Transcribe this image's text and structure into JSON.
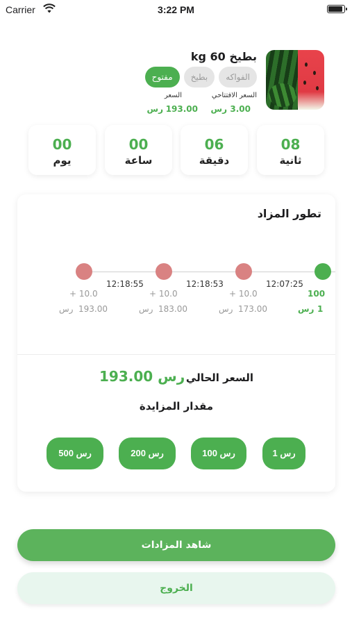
{
  "status_bar": {
    "carrier": "Carrier",
    "time": "3:22 PM"
  },
  "product": {
    "title": "بطيخ 60 kg",
    "tags": {
      "category": "الفواكه",
      "subcategory": "بطيخ",
      "status": "مفتوح"
    },
    "opening_price_label": "السعر الافتتاحي",
    "opening_price": "3.00",
    "price_label": "السعر",
    "price": "193.00",
    "currency": "رس"
  },
  "countdown": {
    "seconds": {
      "value": "08",
      "label": "ثانية"
    },
    "minutes": {
      "value": "06",
      "label": "دقيقة"
    },
    "hours": {
      "value": "00",
      "label": "ساعة"
    },
    "days": {
      "value": "00",
      "label": "يوم"
    }
  },
  "auction": {
    "title": "تطور المزاد",
    "timeline": [
      {
        "time": "12:18:55",
        "increment": "+ 10.0",
        "price": "193.00",
        "currency": "رس"
      },
      {
        "time": "12:18:53",
        "increment": "+ 10.0",
        "price": "183.00",
        "currency": "رس"
      },
      {
        "time": "12:07:25",
        "increment": "+ 10.0",
        "price": "173.00",
        "currency": "رس"
      },
      {
        "time": "",
        "increment": "100",
        "price": "1",
        "currency": "رس"
      }
    ],
    "current_price_label": "السعر الحالي",
    "current_price": "193.00",
    "currency": "رس",
    "bid_amount_label": "مقدار المزايدة",
    "bid_options": [
      "500 رس",
      "200 رس",
      "100 رس",
      "1 رس"
    ]
  },
  "actions": {
    "view_auctions": "شاهد المزادات",
    "exit": "الخروج"
  },
  "colors": {
    "accent": "#4caf50",
    "dot_inactive": "#d98282",
    "secondary_bg": "#e8f6ee"
  }
}
